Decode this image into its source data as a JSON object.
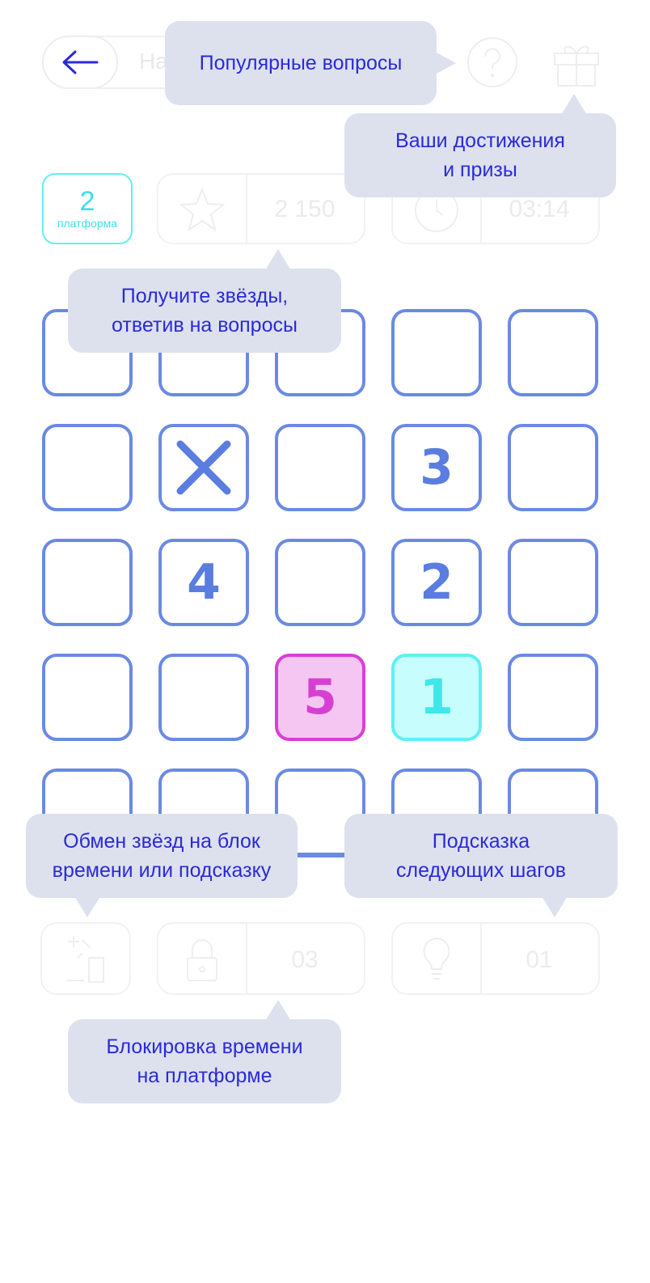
{
  "header": {
    "back_label": "На"
  },
  "stats": {
    "platform_number": "2",
    "platform_label": "платформа",
    "stars_value": "2 150",
    "time_value": "03:14"
  },
  "grid": {
    "rows": [
      [
        "",
        "",
        "",
        "",
        ""
      ],
      [
        "",
        "x",
        "",
        "3",
        ""
      ],
      [
        "",
        "4",
        "",
        "2",
        ""
      ],
      [
        "",
        "",
        "5",
        "1",
        ""
      ],
      [
        "",
        "",
        "",
        "",
        ""
      ]
    ],
    "highlighted": {
      "magenta": "5",
      "cyan": "1"
    }
  },
  "toolbar": {
    "lock_count": "03",
    "hint_count": "01"
  },
  "tooltips": {
    "popular_questions": "Популярные вопросы",
    "achievements": "Ваши достижения\nи призы",
    "get_stars": "Получите звёзды,\nответив на вопросы",
    "exchange_stars": "Обмен звёзд на блок\nвремени или подсказку",
    "next_steps_hint": "Подсказка\nследующих шагов",
    "time_lock": "Блокировка времени\nна платформе"
  },
  "colors": {
    "accent_blue": "#6a8ae3",
    "tooltip_bg": "#dde1ee",
    "tooltip_text": "#2a2ad8",
    "magenta": "#d83fd6",
    "cyan": "#5ff0f3"
  },
  "icons": [
    "back-arrow-icon",
    "help-icon",
    "gift-icon",
    "star-icon",
    "clock-icon",
    "exchange-icon",
    "lock-icon",
    "lightbulb-icon",
    "cross-icon"
  ]
}
